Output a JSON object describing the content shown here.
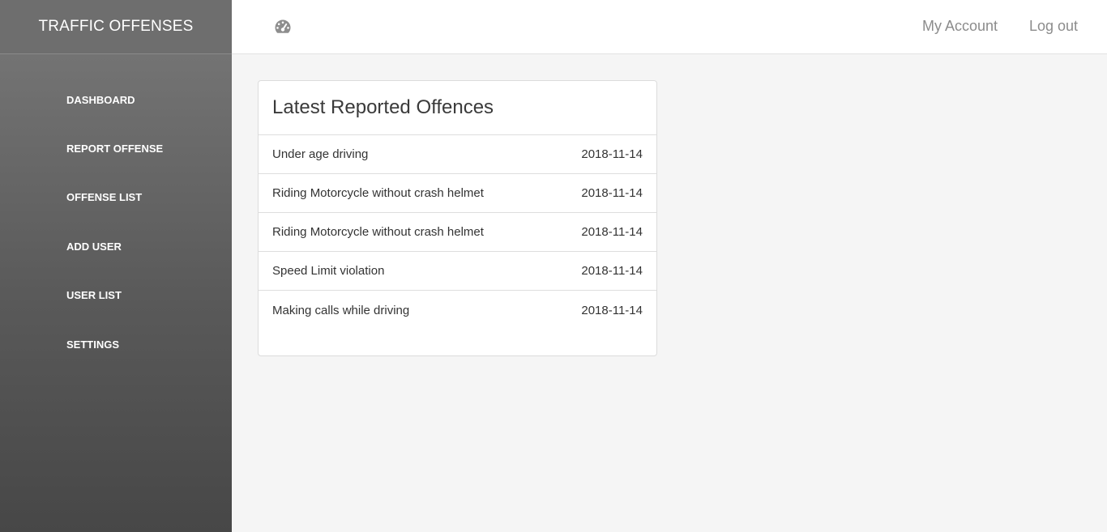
{
  "sidebar": {
    "brand": "TRAFFIC OFFENSES",
    "items": [
      {
        "label": "DASHBOARD"
      },
      {
        "label": "REPORT OFFENSE"
      },
      {
        "label": "OFFENSE LIST"
      },
      {
        "label": "ADD USER"
      },
      {
        "label": "USER LIST"
      },
      {
        "label": "SETTINGS"
      }
    ]
  },
  "topbar": {
    "icon": "dashboard-gauge-icon",
    "my_account": "My Account",
    "logout": "Log out"
  },
  "offences": {
    "title": "Latest Reported Offences",
    "rows": [
      {
        "name": "Under age driving",
        "date": "2018-11-14"
      },
      {
        "name": "Riding Motorcycle without crash helmet",
        "date": "2018-11-14"
      },
      {
        "name": "Riding Motorcycle without crash helmet",
        "date": "2018-11-14"
      },
      {
        "name": "Speed Limit violation",
        "date": "2018-11-14"
      },
      {
        "name": "Making calls while driving",
        "date": "2018-11-14"
      }
    ]
  },
  "colors": {
    "sidebar_top": "#797979",
    "sidebar_bottom": "#474747",
    "content_bg": "#f5f5f5",
    "link_gray": "#8c8c8c"
  }
}
